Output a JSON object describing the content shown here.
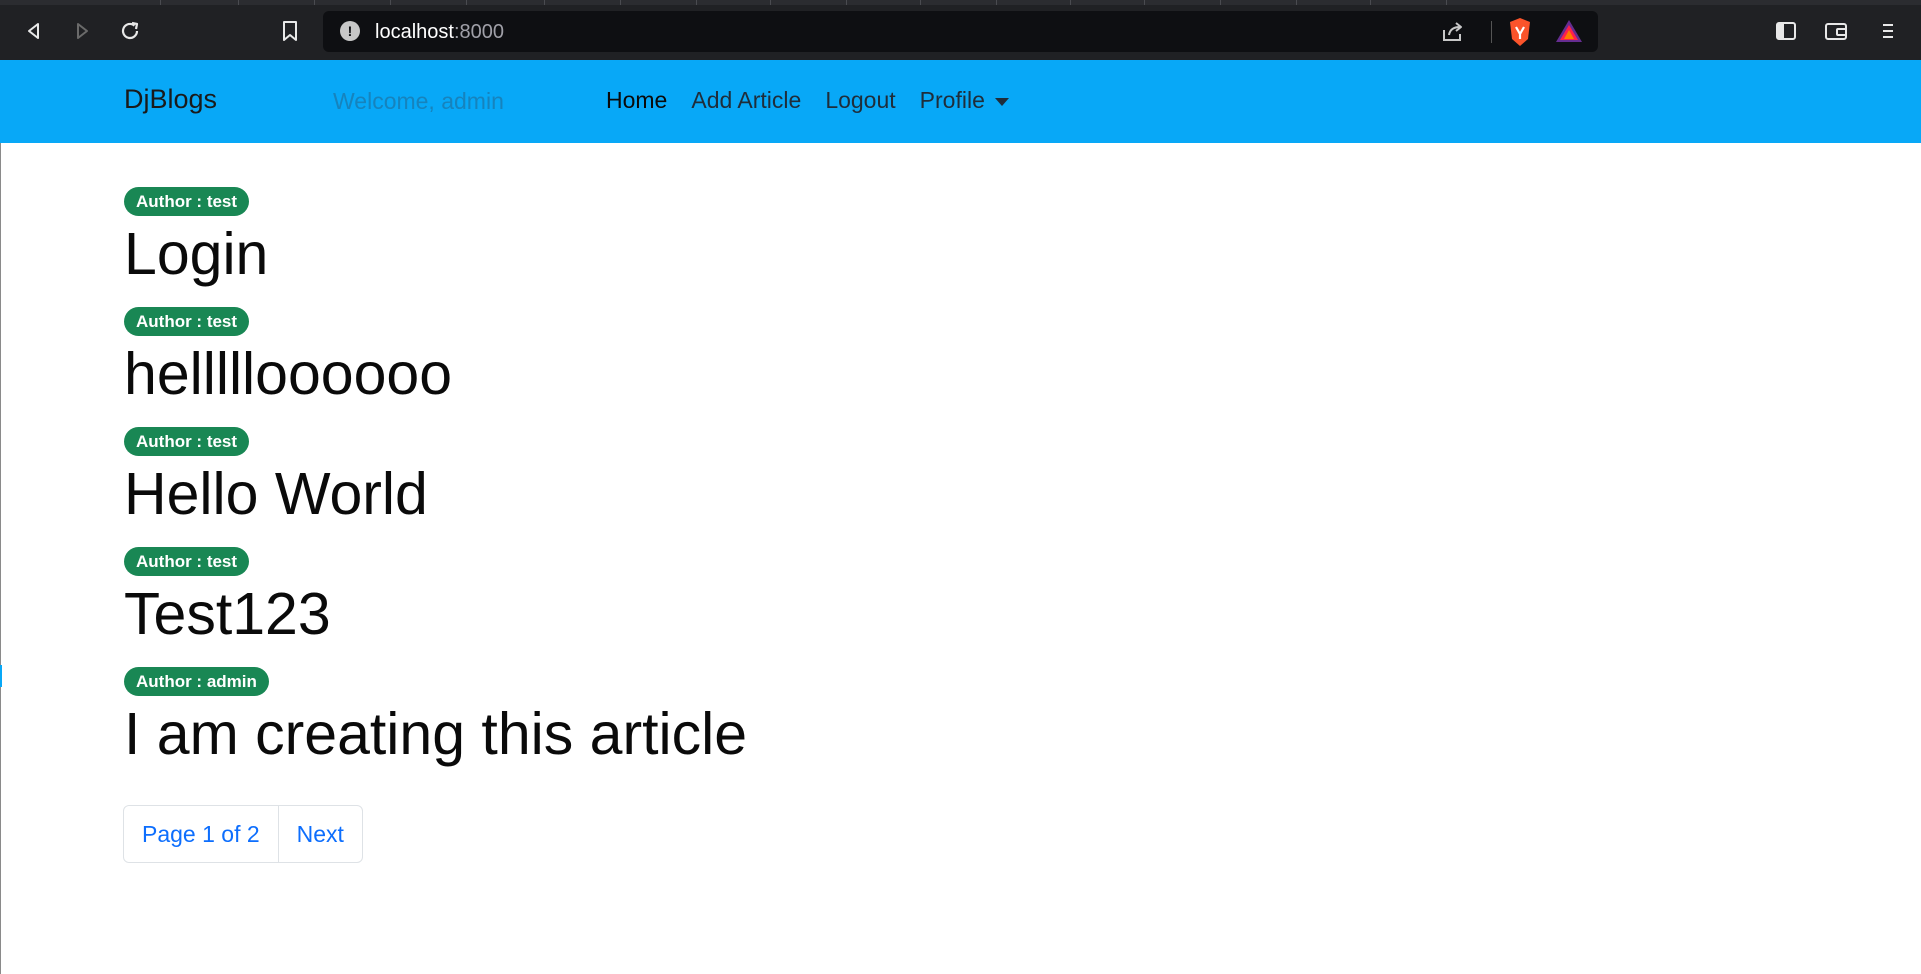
{
  "browser": {
    "url_host": "localhost",
    "url_port": ":8000",
    "icons": [
      "back-icon",
      "forward-icon",
      "reload-icon",
      "bookmark-icon",
      "site-info-icon",
      "share-icon",
      "brave-shield-icon",
      "brave-rewards-icon",
      "sidebar-icon",
      "wallet-icon",
      "menu-icon"
    ]
  },
  "navbar": {
    "brand": "DjBlogs",
    "welcome": "Welcome, admin",
    "links": [
      {
        "label": "Home"
      },
      {
        "label": "Add Article"
      },
      {
        "label": "Logout"
      },
      {
        "label": "Profile"
      }
    ],
    "bg_color": "#08a8f7"
  },
  "articles": [
    {
      "author_badge": "Author : test",
      "title": "Login"
    },
    {
      "author_badge": "Author : test",
      "title": "hellllloooooo"
    },
    {
      "author_badge": "Author : test",
      "title": "Hello World"
    },
    {
      "author_badge": "Author : test",
      "title": "Test123"
    },
    {
      "author_badge": "Author : admin",
      "title": "I am creating this article"
    }
  ],
  "pagination": {
    "page_info": "Page 1 of 2",
    "next": "Next"
  },
  "colors": {
    "badge": "#198754",
    "link": "#0d6efd"
  }
}
